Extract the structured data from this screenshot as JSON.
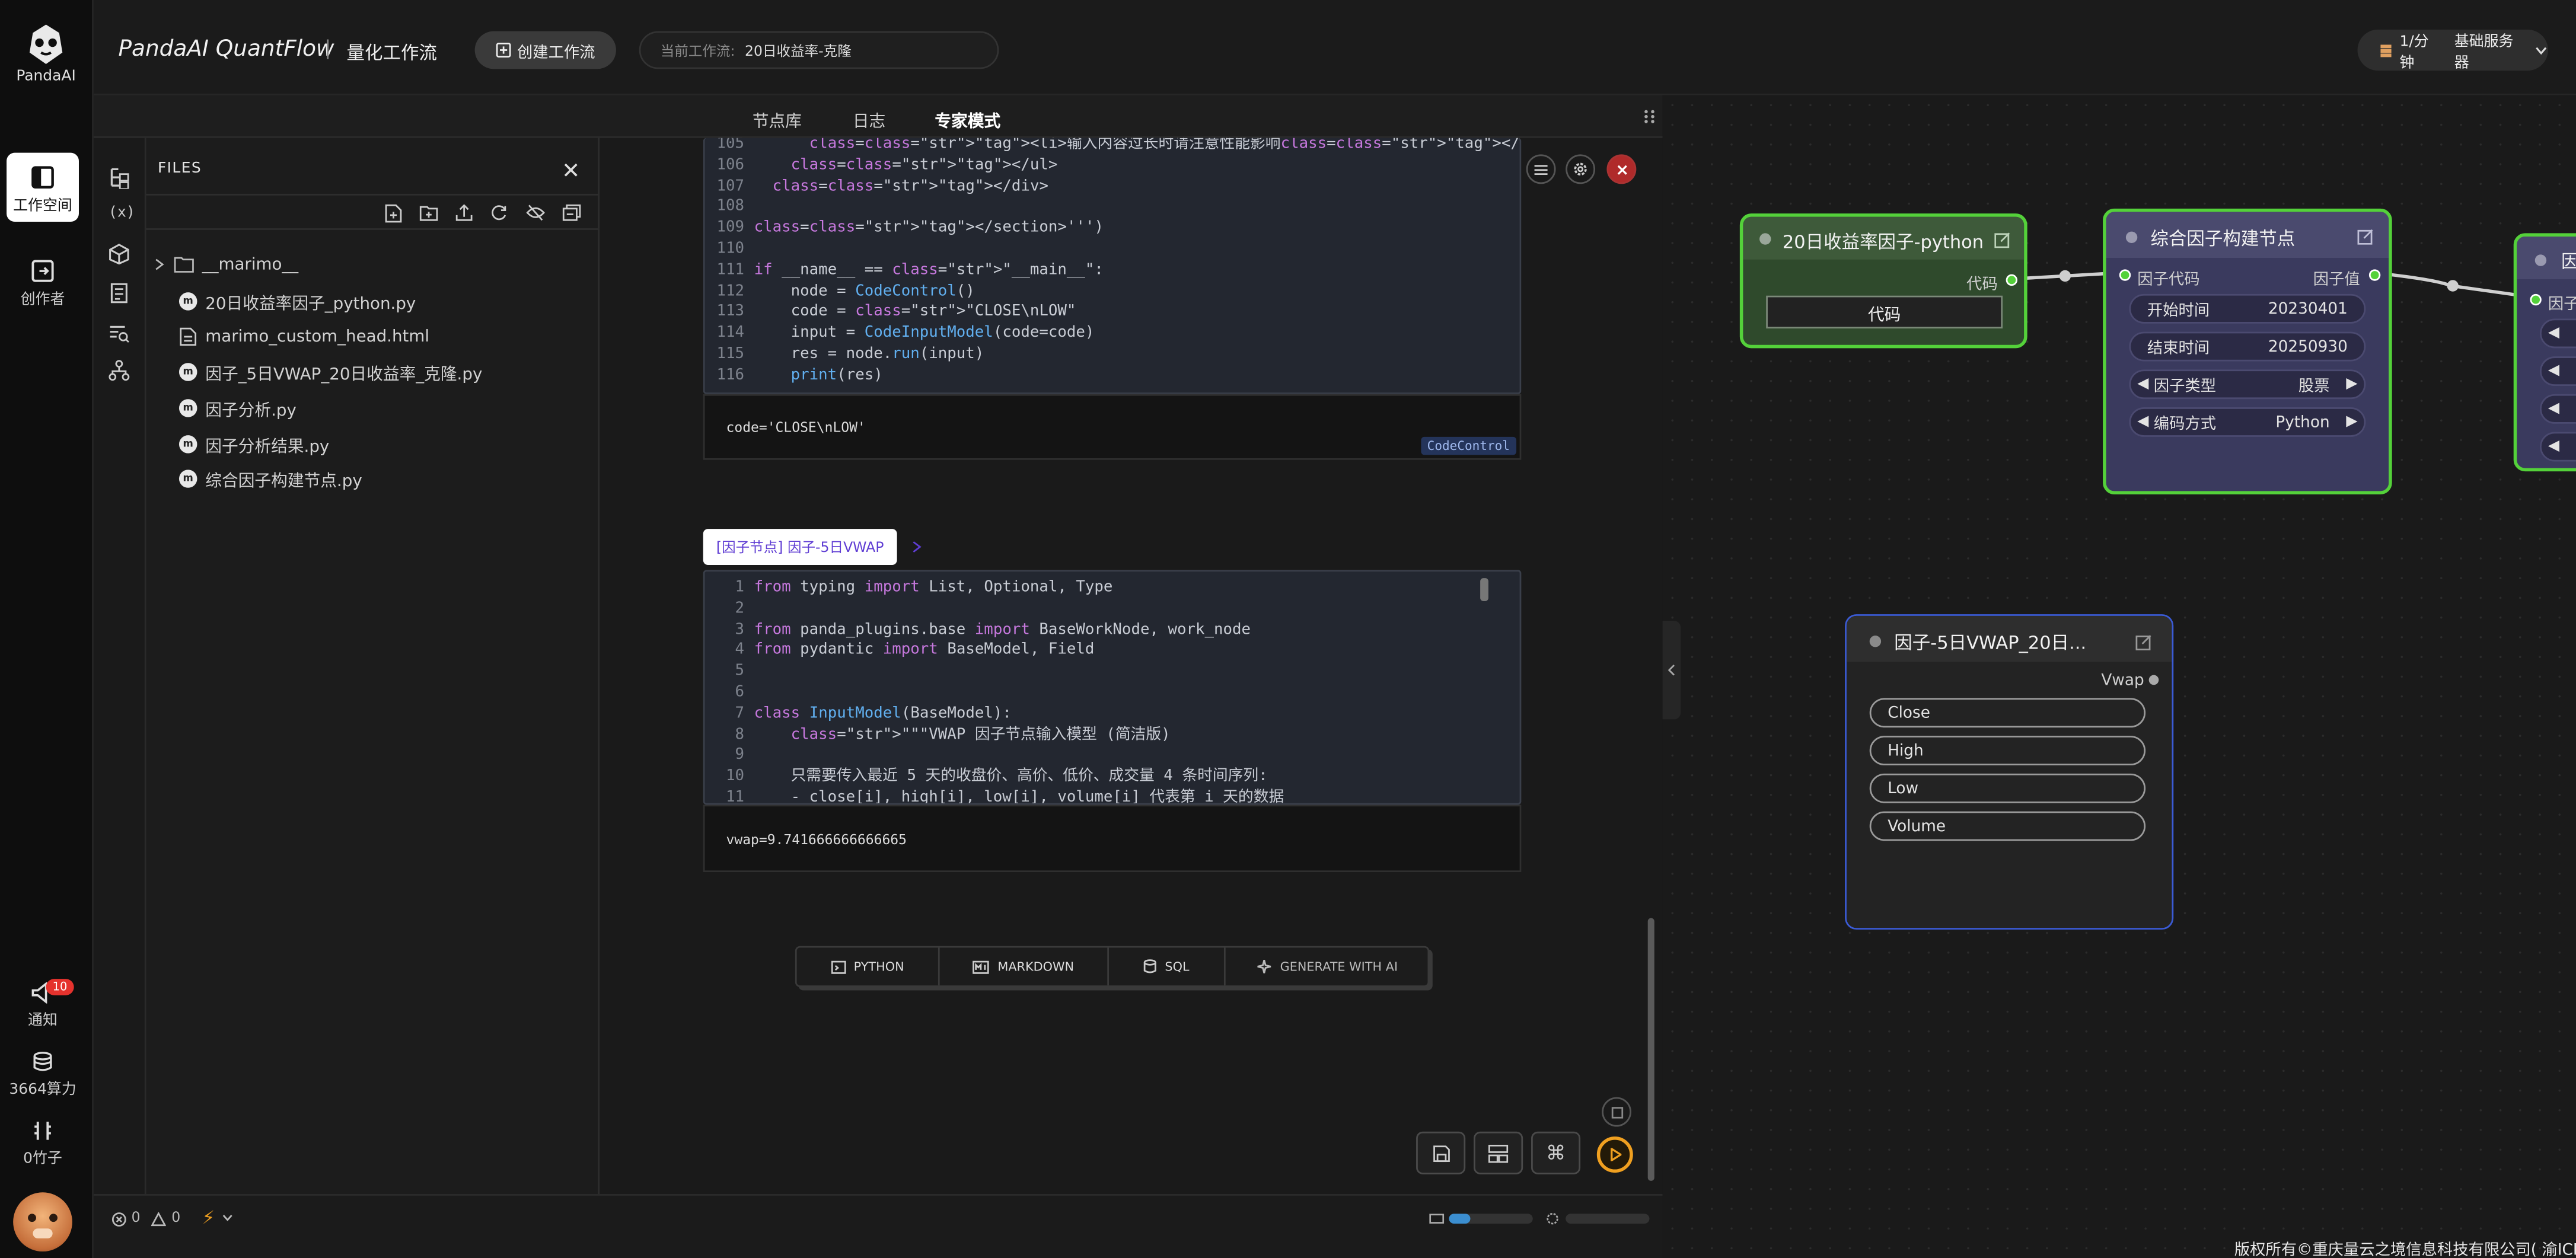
{
  "app": {
    "brand_short": "PandaAI",
    "title": "PandaAI QuantFlow",
    "subtitle": "量化工作流"
  },
  "header": {
    "create_button": "创建工作流",
    "current_label": "当前工作流:",
    "current_value": "20日收益率-克隆",
    "server_price": "1/分钟",
    "server_name": "基础服务器"
  },
  "rail": {
    "items": [
      {
        "label": "工作空间",
        "icon": "workspace-icon"
      },
      {
        "label": "创作者",
        "icon": "creator-icon"
      }
    ],
    "bottom": [
      {
        "label": "通知",
        "badge": "10",
        "icon": "notification-icon"
      },
      {
        "label": "3664算力",
        "icon": "compute-icon"
      },
      {
        "label": "0竹子",
        "icon": "bamboo-icon"
      }
    ]
  },
  "tabs": [
    "节点库",
    "日志",
    "专家模式"
  ],
  "files": {
    "title": "FILES",
    "folder": "__marimo__",
    "items": [
      "20日收益率因子_python.py",
      "marimo_custom_head.html",
      "因子_5日VWAP_20日收益率_克隆.py",
      "因子分析.py",
      "因子分析结果.py",
      "综合因子构建节点.py"
    ]
  },
  "cell1": {
    "lines": [
      {
        "n": "105",
        "t": "      <li>输入内容过长时请注意性能影响</li>"
      },
      {
        "n": "106",
        "t": "    </ul>"
      },
      {
        "n": "107",
        "t": "  </div>"
      },
      {
        "n": "108",
        "t": ""
      },
      {
        "n": "109",
        "t": "</section>''')"
      },
      {
        "n": "110",
        "t": ""
      },
      {
        "n": "111",
        "t": "if __name__ == \"__main__\":"
      },
      {
        "n": "112",
        "t": "    node = CodeControl()"
      },
      {
        "n": "113",
        "t": "    code = \"CLOSE\\nLOW\""
      },
      {
        "n": "114",
        "t": "    input = CodeInputModel(code=code)"
      },
      {
        "n": "115",
        "t": "    res = node.run(input)"
      },
      {
        "n": "116",
        "t": "    print(res)"
      }
    ],
    "output": "code='CLOSE\\nLOW'",
    "badge": "CodeControl"
  },
  "cell2": {
    "label": "[因子节点] 因子-5日VWAP",
    "lines": [
      {
        "n": "1",
        "t": "from typing import List, Optional, Type"
      },
      {
        "n": "2",
        "t": ""
      },
      {
        "n": "3",
        "t": "from panda_plugins.base import BaseWorkNode, work_node"
      },
      {
        "n": "4",
        "t": "from pydantic import BaseModel, Field"
      },
      {
        "n": "5",
        "t": ""
      },
      {
        "n": "6",
        "t": ""
      },
      {
        "n": "7",
        "t": "class InputModel(BaseModel):"
      },
      {
        "n": "8",
        "t": "    \"\"\"VWAP 因子节点输入模型 (简洁版)"
      },
      {
        "n": "9",
        "t": ""
      },
      {
        "n": "10",
        "t": "    只需要传入最近 5 天的收盘价、高价、低价、成交量 4 条时间序列:"
      },
      {
        "n": "11",
        "t": "    - close[i], high[i], low[i], volume[i] 代表第 i 天的数据"
      }
    ],
    "output": "vwap=9.741666666666665"
  },
  "add_cell": [
    "PYTHON",
    "MARKDOWN",
    "SQL",
    "GENERATE WITH AI"
  ],
  "status": {
    "errors": "0",
    "warnings": "0"
  },
  "nodes": {
    "n1": {
      "title": "20日收益率因子-python",
      "out_label": "代码",
      "button": "代码"
    },
    "n2": {
      "title": "综合因子构建节点",
      "in_label": "因子代码",
      "out_label": "因子值",
      "fields": [
        {
          "label": "开始时间",
          "value": "20230401"
        },
        {
          "label": "结束时间",
          "value": "20250930"
        },
        {
          "label": "因子类型",
          "value": "股票"
        },
        {
          "label": "编码方式",
          "value": "Python"
        }
      ]
    },
    "n3": {
      "title": "因",
      "in_label": "因子"
    },
    "n4": {
      "title": "因子-5日VWAP_20日...",
      "out_label": "Vwap",
      "fields": [
        "Close",
        "High",
        "Low",
        "Volume"
      ]
    }
  },
  "footer": {
    "copyright": "版权所有©重庆量云之境信息科技有限公司( 渝ICP"
  },
  "colors": {
    "green": "#54d13a",
    "purple": "#7a5de0",
    "blue": "#3b5bd6",
    "accent": "#f0a020"
  }
}
